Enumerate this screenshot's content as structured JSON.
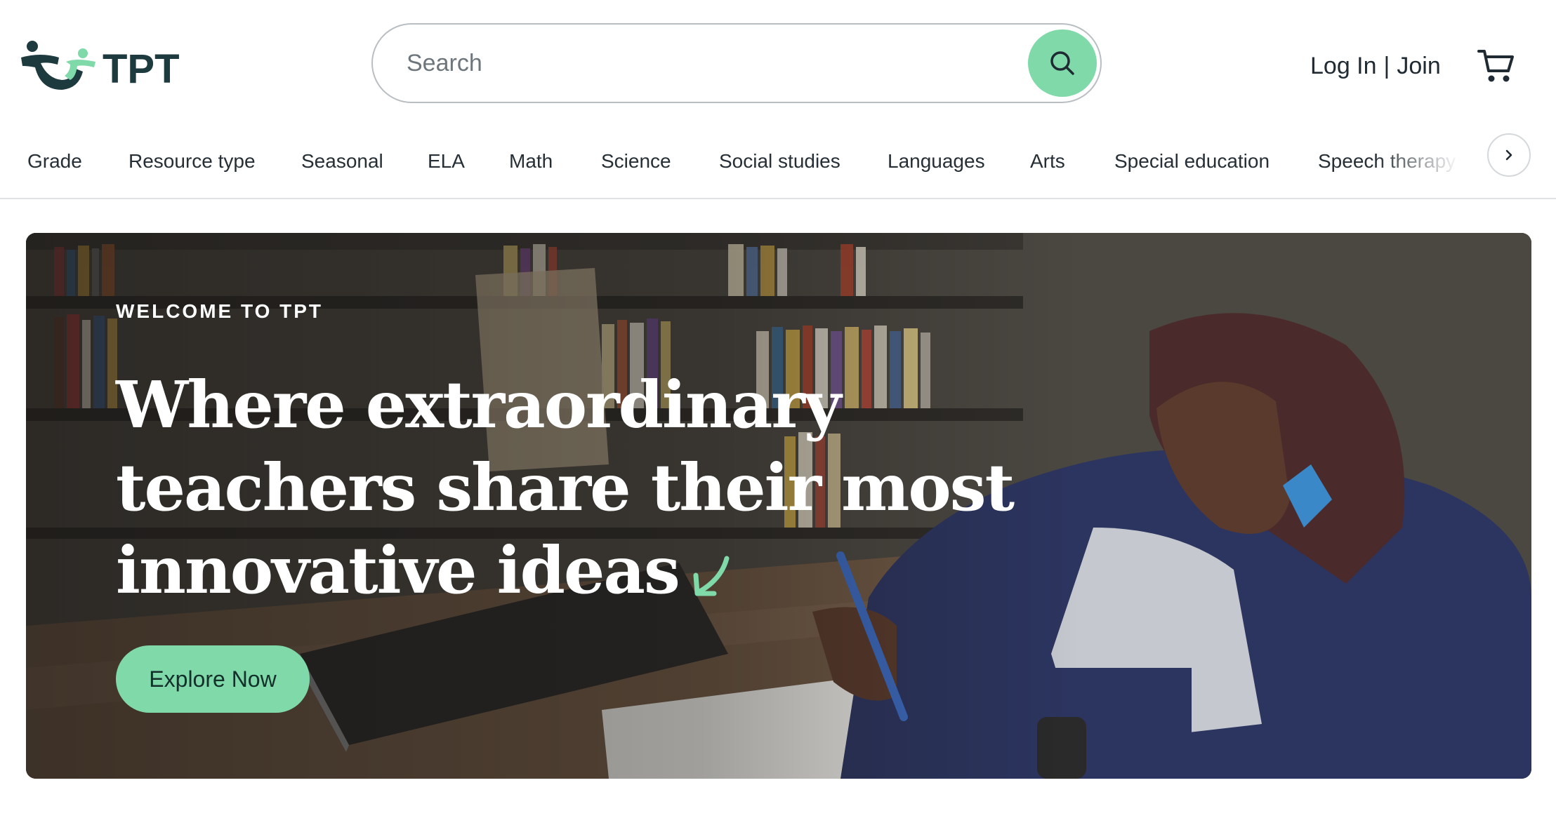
{
  "header": {
    "brand": "TPT",
    "search": {
      "placeholder": "Search",
      "value": ""
    },
    "login_label": "Log In",
    "separator": "|",
    "join_label": "Join"
  },
  "nav": {
    "items": [
      "Grade",
      "Resource type",
      "Seasonal",
      "ELA",
      "Math",
      "Science",
      "Social studies",
      "Languages",
      "Arts",
      "Special education",
      "Speech therapy"
    ]
  },
  "hero": {
    "eyebrow": "WELCOME TO TPT",
    "headline_lines": [
      "Where extraordinary",
      "teachers share their most",
      "innovative ideas"
    ],
    "cta_label": "Explore Now"
  },
  "colors": {
    "brand_dark": "#1d3a3e",
    "brand_green": "#7fd9a9",
    "text": "#1f2a33"
  },
  "icons": [
    "search-icon",
    "cart-icon",
    "chevron-right-icon",
    "arrow-down-left-icon"
  ]
}
